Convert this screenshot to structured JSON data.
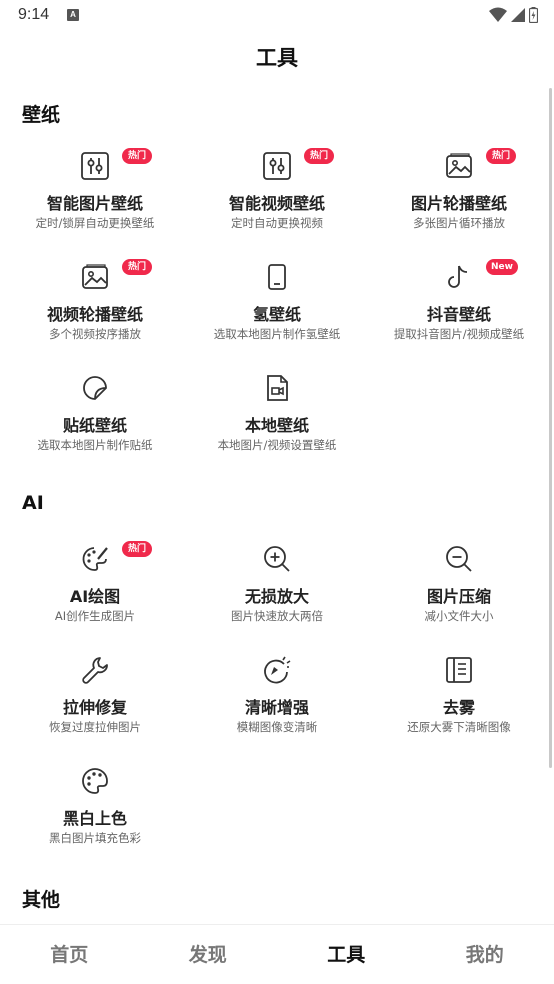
{
  "status_bar": {
    "time": "9:14",
    "notification_glyph": "A"
  },
  "page_title": "工具",
  "sections": {
    "wallpaper": {
      "title": "壁纸",
      "items": [
        {
          "name": "智能图片壁纸",
          "desc": "定时/锁屏自动更换壁纸",
          "badge": "热门",
          "icon": "sliders-icon"
        },
        {
          "name": "智能视频壁纸",
          "desc": "定时自动更换视频",
          "badge": "热门",
          "icon": "sliders-icon"
        },
        {
          "name": "图片轮播壁纸",
          "desc": "多张图片循环播放",
          "badge": "热门",
          "icon": "image-stack-icon"
        },
        {
          "name": "视频轮播壁纸",
          "desc": "多个视频按序播放",
          "badge": "热门",
          "icon": "image-stack-icon"
        },
        {
          "name": "氢壁纸",
          "desc": "选取本地图片制作氢壁纸",
          "badge": "",
          "icon": "phone-icon"
        },
        {
          "name": "抖音壁纸",
          "desc": "提取抖音图片/视频成壁纸",
          "badge": "New",
          "icon": "tiktok-icon"
        },
        {
          "name": "贴纸壁纸",
          "desc": "选取本地图片制作贴纸",
          "badge": "",
          "icon": "sticker-icon"
        },
        {
          "name": "本地壁纸",
          "desc": "本地图片/视频设置壁纸",
          "badge": "",
          "icon": "local-file-icon"
        }
      ]
    },
    "ai": {
      "title": "AI",
      "items": [
        {
          "name": "AI绘图",
          "desc": "AI创作生成图片",
          "badge": "热门",
          "icon": "palette-brush-icon"
        },
        {
          "name": "无损放大",
          "desc": "图片快速放大两倍",
          "badge": "",
          "icon": "zoom-in-icon"
        },
        {
          "name": "图片压缩",
          "desc": "减小文件大小",
          "badge": "",
          "icon": "zoom-out-icon"
        },
        {
          "name": "拉伸修复",
          "desc": "恢复过度拉伸图片",
          "badge": "",
          "icon": "wrench-icon"
        },
        {
          "name": "清晰增强",
          "desc": "模糊图像变清晰",
          "badge": "",
          "icon": "enhance-icon"
        },
        {
          "name": "去雾",
          "desc": "还原大雾下清晰图像",
          "badge": "",
          "icon": "dehaze-icon"
        },
        {
          "name": "黑白上色",
          "desc": "黑白图片填充色彩",
          "badge": "",
          "icon": "palette-icon"
        }
      ]
    },
    "other": {
      "title": "其他"
    }
  },
  "bottom_nav": {
    "tabs": [
      {
        "label": "首页",
        "active": false
      },
      {
        "label": "发现",
        "active": false
      },
      {
        "label": "工具",
        "active": true
      },
      {
        "label": "我的",
        "active": false
      }
    ]
  },
  "colors": {
    "badge": "#f0294b",
    "text_primary": "#222222",
    "text_secondary": "#666666"
  }
}
